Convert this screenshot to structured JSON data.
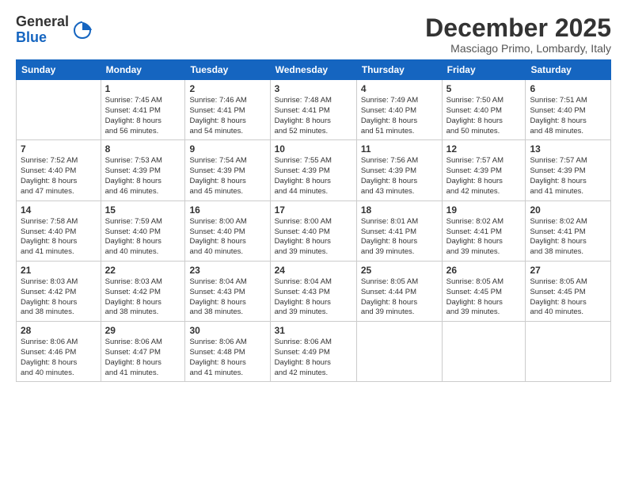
{
  "logo": {
    "general": "General",
    "blue": "Blue"
  },
  "header": {
    "month": "December 2025",
    "location": "Masciago Primo, Lombardy, Italy"
  },
  "weekdays": [
    "Sunday",
    "Monday",
    "Tuesday",
    "Wednesday",
    "Thursday",
    "Friday",
    "Saturday"
  ],
  "weeks": [
    [
      {
        "day": "",
        "info": ""
      },
      {
        "day": "1",
        "info": "Sunrise: 7:45 AM\nSunset: 4:41 PM\nDaylight: 8 hours\nand 56 minutes."
      },
      {
        "day": "2",
        "info": "Sunrise: 7:46 AM\nSunset: 4:41 PM\nDaylight: 8 hours\nand 54 minutes."
      },
      {
        "day": "3",
        "info": "Sunrise: 7:48 AM\nSunset: 4:41 PM\nDaylight: 8 hours\nand 52 minutes."
      },
      {
        "day": "4",
        "info": "Sunrise: 7:49 AM\nSunset: 4:40 PM\nDaylight: 8 hours\nand 51 minutes."
      },
      {
        "day": "5",
        "info": "Sunrise: 7:50 AM\nSunset: 4:40 PM\nDaylight: 8 hours\nand 50 minutes."
      },
      {
        "day": "6",
        "info": "Sunrise: 7:51 AM\nSunset: 4:40 PM\nDaylight: 8 hours\nand 48 minutes."
      }
    ],
    [
      {
        "day": "7",
        "info": "Sunrise: 7:52 AM\nSunset: 4:40 PM\nDaylight: 8 hours\nand 47 minutes."
      },
      {
        "day": "8",
        "info": "Sunrise: 7:53 AM\nSunset: 4:39 PM\nDaylight: 8 hours\nand 46 minutes."
      },
      {
        "day": "9",
        "info": "Sunrise: 7:54 AM\nSunset: 4:39 PM\nDaylight: 8 hours\nand 45 minutes."
      },
      {
        "day": "10",
        "info": "Sunrise: 7:55 AM\nSunset: 4:39 PM\nDaylight: 8 hours\nand 44 minutes."
      },
      {
        "day": "11",
        "info": "Sunrise: 7:56 AM\nSunset: 4:39 PM\nDaylight: 8 hours\nand 43 minutes."
      },
      {
        "day": "12",
        "info": "Sunrise: 7:57 AM\nSunset: 4:39 PM\nDaylight: 8 hours\nand 42 minutes."
      },
      {
        "day": "13",
        "info": "Sunrise: 7:57 AM\nSunset: 4:39 PM\nDaylight: 8 hours\nand 41 minutes."
      }
    ],
    [
      {
        "day": "14",
        "info": "Sunrise: 7:58 AM\nSunset: 4:40 PM\nDaylight: 8 hours\nand 41 minutes."
      },
      {
        "day": "15",
        "info": "Sunrise: 7:59 AM\nSunset: 4:40 PM\nDaylight: 8 hours\nand 40 minutes."
      },
      {
        "day": "16",
        "info": "Sunrise: 8:00 AM\nSunset: 4:40 PM\nDaylight: 8 hours\nand 40 minutes."
      },
      {
        "day": "17",
        "info": "Sunrise: 8:00 AM\nSunset: 4:40 PM\nDaylight: 8 hours\nand 39 minutes."
      },
      {
        "day": "18",
        "info": "Sunrise: 8:01 AM\nSunset: 4:41 PM\nDaylight: 8 hours\nand 39 minutes."
      },
      {
        "day": "19",
        "info": "Sunrise: 8:02 AM\nSunset: 4:41 PM\nDaylight: 8 hours\nand 39 minutes."
      },
      {
        "day": "20",
        "info": "Sunrise: 8:02 AM\nSunset: 4:41 PM\nDaylight: 8 hours\nand 38 minutes."
      }
    ],
    [
      {
        "day": "21",
        "info": "Sunrise: 8:03 AM\nSunset: 4:42 PM\nDaylight: 8 hours\nand 38 minutes."
      },
      {
        "day": "22",
        "info": "Sunrise: 8:03 AM\nSunset: 4:42 PM\nDaylight: 8 hours\nand 38 minutes."
      },
      {
        "day": "23",
        "info": "Sunrise: 8:04 AM\nSunset: 4:43 PM\nDaylight: 8 hours\nand 38 minutes."
      },
      {
        "day": "24",
        "info": "Sunrise: 8:04 AM\nSunset: 4:43 PM\nDaylight: 8 hours\nand 39 minutes."
      },
      {
        "day": "25",
        "info": "Sunrise: 8:05 AM\nSunset: 4:44 PM\nDaylight: 8 hours\nand 39 minutes."
      },
      {
        "day": "26",
        "info": "Sunrise: 8:05 AM\nSunset: 4:45 PM\nDaylight: 8 hours\nand 39 minutes."
      },
      {
        "day": "27",
        "info": "Sunrise: 8:05 AM\nSunset: 4:45 PM\nDaylight: 8 hours\nand 40 minutes."
      }
    ],
    [
      {
        "day": "28",
        "info": "Sunrise: 8:06 AM\nSunset: 4:46 PM\nDaylight: 8 hours\nand 40 minutes."
      },
      {
        "day": "29",
        "info": "Sunrise: 8:06 AM\nSunset: 4:47 PM\nDaylight: 8 hours\nand 41 minutes."
      },
      {
        "day": "30",
        "info": "Sunrise: 8:06 AM\nSunset: 4:48 PM\nDaylight: 8 hours\nand 41 minutes."
      },
      {
        "day": "31",
        "info": "Sunrise: 8:06 AM\nSunset: 4:49 PM\nDaylight: 8 hours\nand 42 minutes."
      },
      {
        "day": "",
        "info": ""
      },
      {
        "day": "",
        "info": ""
      },
      {
        "day": "",
        "info": ""
      }
    ]
  ]
}
